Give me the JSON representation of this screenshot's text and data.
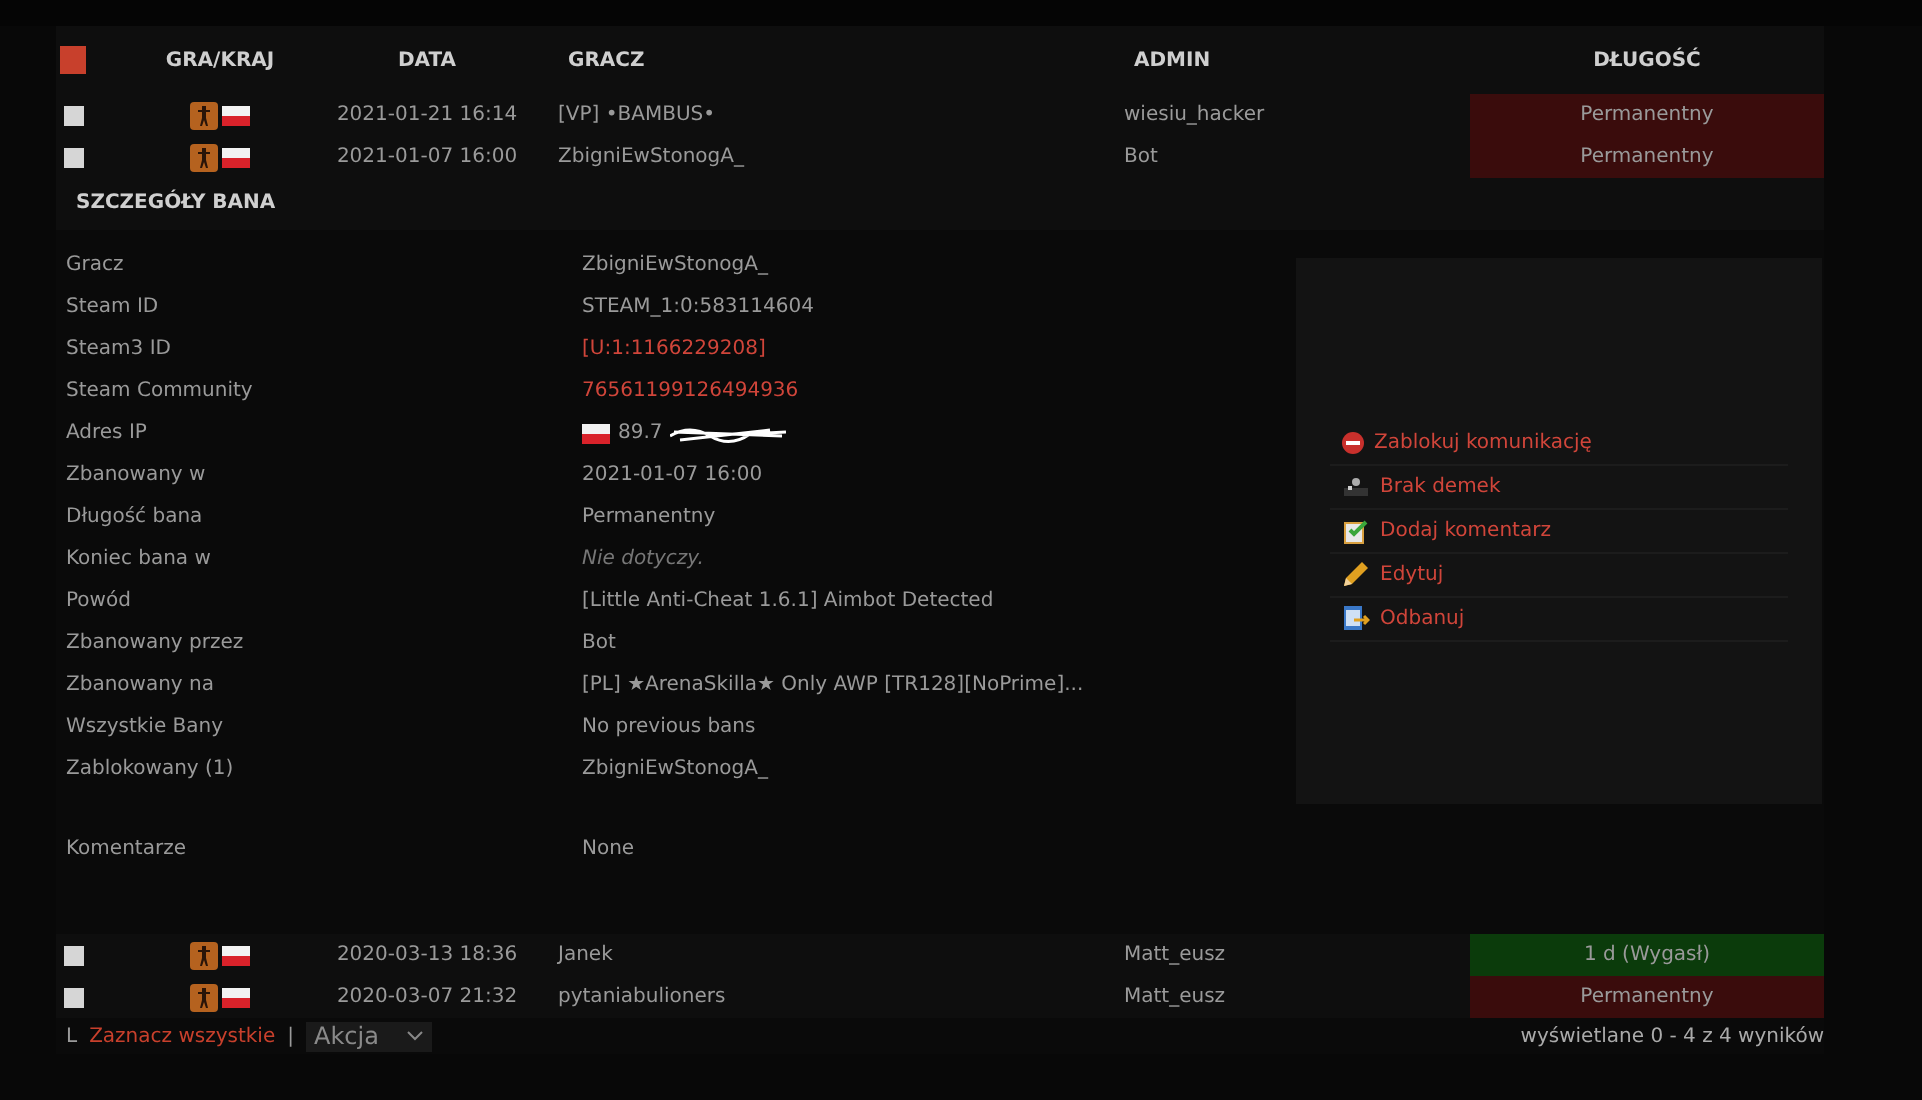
{
  "table": {
    "select_all": {
      "checked": true
    },
    "columns": [
      "GRA/KRAJ",
      "DATA",
      "GRACZ",
      "ADMIN",
      "DŁUGOŚĆ"
    ],
    "rows": [
      {
        "checked": false,
        "date": "2021-01-21 16:14",
        "player": "[VP] •BAMBUS•",
        "admin": "wiesiu_hacker",
        "length": "Permanentny",
        "color": "#3a0c0c"
      },
      {
        "checked": false,
        "date": "2021-01-07 16:00",
        "player": "ZbigniEwStonogA_",
        "admin": "Bot",
        "length": "Permanentny",
        "color": "#3a0c0c"
      }
    ],
    "rows_after": [
      {
        "checked": false,
        "date": "2020-03-13 18:36",
        "player": "Janek",
        "admin": "Matt_eusz",
        "length": "1 d (Wygasł)",
        "color": "#0b3b0b"
      },
      {
        "checked": false,
        "date": "2020-03-07 21:32",
        "player": "pytaniabulioners",
        "admin": "Matt_eusz",
        "length": "Permanentny",
        "color": "#3a0c0c"
      }
    ]
  },
  "details": {
    "title": "SZCZEGÓŁY BANA",
    "fields": [
      {
        "kind": "text",
        "label": "Gracz",
        "value": "ZbigniEwStonogA_"
      },
      {
        "kind": "text",
        "label": "Steam ID",
        "value": "STEAM_1:0:583114604"
      },
      {
        "kind": "link",
        "label": "Steam3 ID",
        "value": "[U:1:1166229208]"
      },
      {
        "kind": "link",
        "label": "Steam Community",
        "value": "76561199126494936"
      },
      {
        "kind": "ip",
        "label": "Adres IP",
        "value": "89.7"
      },
      {
        "kind": "text",
        "label": "Zbanowany w",
        "value": "2021-01-07 16:00"
      },
      {
        "kind": "text",
        "label": "Długość bana",
        "value": "Permanentny"
      },
      {
        "kind": "note",
        "label": "Koniec bana w",
        "value": "Nie dotyczy."
      },
      {
        "kind": "text",
        "label": "Powód",
        "value": "[Little Anti-Cheat 1.6.1] Aimbot Detected"
      },
      {
        "kind": "text",
        "label": "Zbanowany przez",
        "value": "Bot"
      },
      {
        "kind": "text",
        "label": "Zbanowany na",
        "value": "[PL] ★ArenaSkilla★ Only AWP [TR128][NoPrime]..."
      },
      {
        "kind": "text",
        "label": "Wszystkie Bany",
        "value": "No previous bans"
      },
      {
        "kind": "text",
        "label": "Zablokowany (1)",
        "value": "ZbigniEwStonogA_"
      },
      {
        "kind": "comment",
        "label": "Komentarze",
        "value": "None"
      }
    ],
    "actions": [
      "Zablokuj komunikację",
      "Brak demek",
      "Dodaj komentarz",
      "Edytuj",
      "Odbanuj"
    ]
  },
  "footer": {
    "corner": "L",
    "select_all": "Zaznacz wszystkie",
    "separator": "|",
    "action_select": "Akcja",
    "summary": "wyświetlane 0 - 4 z 4 wyników"
  }
}
